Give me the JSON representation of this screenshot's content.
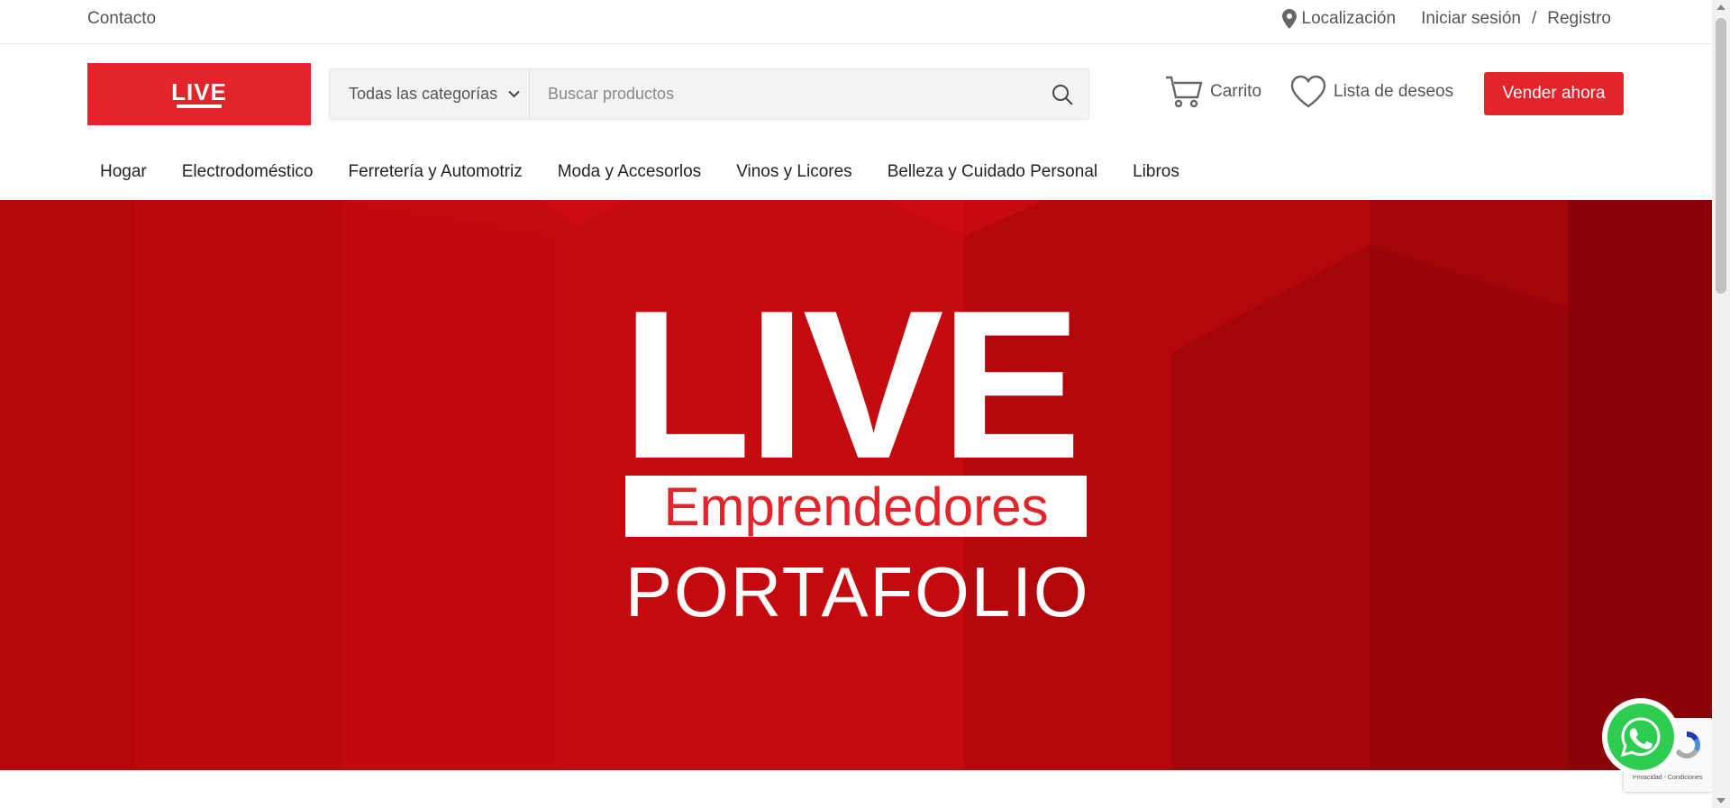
{
  "topbar": {
    "contact": "Contacto",
    "location": "Localización",
    "login": "Iniciar sesión",
    "separator": "/",
    "register": "Registro"
  },
  "header": {
    "logo_text": "LIVE",
    "search": {
      "category": "Todas las categorías",
      "placeholder": "Buscar productos"
    },
    "cart": "Carrito",
    "wishlist": "Lista de deseos",
    "sell": "Vender ahora"
  },
  "nav": {
    "items": [
      "Hogar",
      "Electrodoméstico",
      "Ferretería y Automotriz",
      "Moda y Accesorlos",
      "Vinos y Licores",
      "Belleza y Cuidado Personal",
      "Libros"
    ]
  },
  "banner": {
    "title": "LIVE",
    "subtitle": "Emprendedores",
    "tagline": "PORTAFOLIO"
  },
  "recaptcha": {
    "text": "Privacidad - Condiciones"
  },
  "colors": {
    "brand": "#e3242b",
    "banner_bg": "#c40a0f"
  }
}
